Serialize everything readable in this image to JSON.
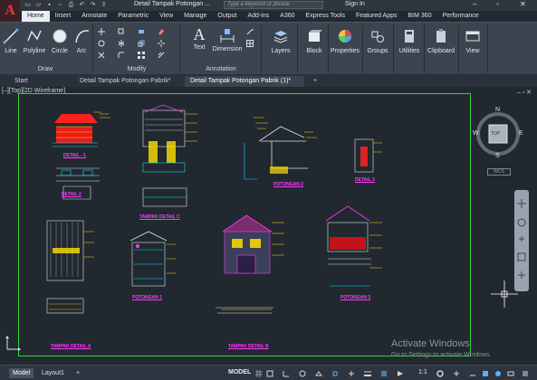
{
  "app": {
    "logo": "A",
    "title": "Detail Tampak Potongan ...",
    "search_placeholder": "Type a keyword or phrase",
    "signin": "Sign In"
  },
  "ribbon_tabs": [
    "Home",
    "Insert",
    "Annotate",
    "Parametric",
    "View",
    "Manage",
    "Output",
    "Add-ins",
    "A360",
    "Express Tools",
    "Featured Apps",
    "BIM 360",
    "Performance"
  ],
  "ribbon": {
    "draw": {
      "label": "Draw",
      "tools": [
        "Line",
        "Polyline",
        "Circle",
        "Arc"
      ]
    },
    "modify": {
      "label": "Modify"
    },
    "annotation": {
      "label": "Annotation",
      "tools": [
        "Text",
        "Dimension"
      ]
    },
    "large_tools": [
      "Layers",
      "Block",
      "Properties",
      "Groups",
      "Utilities",
      "Clipboard",
      "View"
    ]
  },
  "doc_tabs": {
    "start": "Start",
    "tab1": "Detail Tampak Potongan Pabrik*",
    "tab2": "Detail Tampak Potongan Pabrik (1)*",
    "plus": "+"
  },
  "viewport": {
    "label": "[–][Top][2D Wireframe]",
    "controls": "– ▫ ✕"
  },
  "drawing_labels": {
    "detail_1": "DETAIL - 1",
    "detail_2": "DETAIL 2",
    "tampak_detail_a": "TAMPAK DETAIL A",
    "tampak_detail_b": "TAMPAK DETAIL B",
    "tampak_detail_c": "TAMPAK DETAIL C",
    "potongan_1": "POTONGAN 1",
    "potongan_2": "POTONGAN 2",
    "potongan_3": "POTONGAN 3",
    "detail_3": "DETAIL 3"
  },
  "navigation": {
    "compass": {
      "n": "N",
      "s": "S",
      "e": "E",
      "w": "W",
      "top": "TOP"
    },
    "wcs": "WCS"
  },
  "watermark": {
    "title": "Activate Windows",
    "subtitle": "Go to Settings to activate Windows."
  },
  "status": {
    "model_tab": "Model",
    "layout_tab": "Layout1",
    "plus": "+",
    "model_button": "MODEL",
    "scale": "1:1"
  }
}
